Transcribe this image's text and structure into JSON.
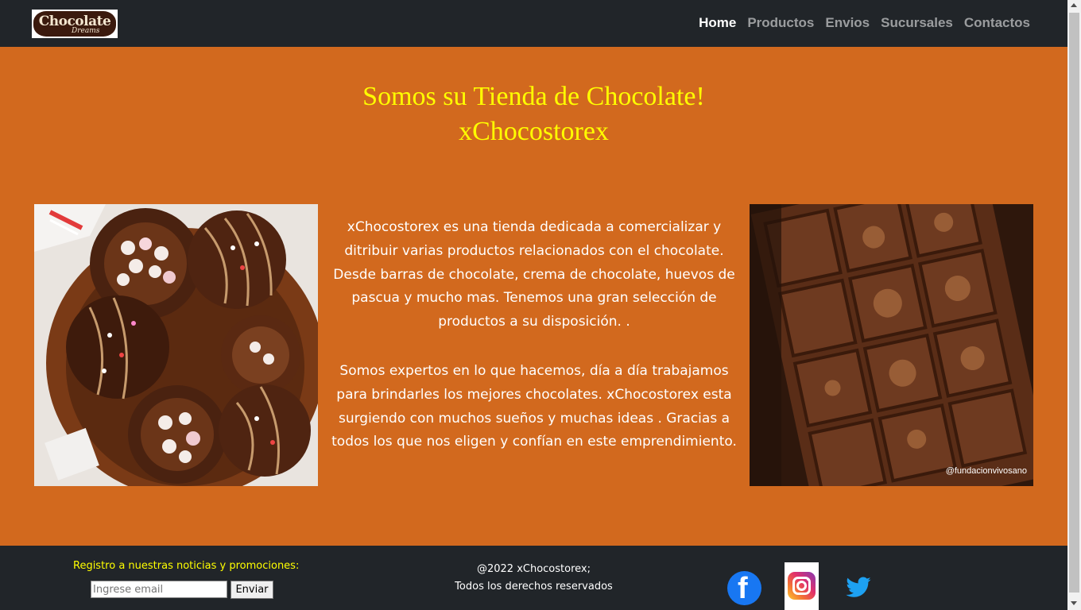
{
  "navbar": {
    "logo_text": "Chocolate",
    "logo_sub": "Dreams",
    "links": [
      "Home",
      "Productos",
      "Envios",
      "Sucursales",
      "Contactos"
    ],
    "active": "Home"
  },
  "hero": {
    "title_line1": "Somos su Tienda de Chocolate!",
    "title_line2": "xChocostorex"
  },
  "description": {
    "paragraph1": "xChocostorex es una tienda dedicada a comercializar y ditribuir varias productos relacionados con el chocolate. Desde barras de chocolate, crema de chocolate, huevos de pascua y mucho mas. Tenemos una gran selección de productos a su disposición. .",
    "paragraph2": "Somos expertos en lo que hacemos, día a día trabajamos para brindarles los mejores chocolates. xChocostorex esta surgiendo con muchos sueños y muchas ideas . Gracias a todos los que nos eligen y confían en este emprendimiento."
  },
  "images": {
    "left_watermark": "",
    "right_watermark": "@fundacionvivosano"
  },
  "footer": {
    "newsletter_label": "Registro a nuestras noticias y promociones:",
    "email_placeholder": "Ingrese email",
    "send_label": "Enviar",
    "copyright_line1": "@2022 xChocostorex;",
    "copyright_line2": "Todos los derechos reservados",
    "social": [
      "facebook-icon",
      "instagram-icon",
      "twitter-icon"
    ]
  },
  "colors": {
    "nav_bg": "#212529",
    "page_bg": "#d2691e",
    "title": "#ffff00",
    "facebook": "#1877f2",
    "twitter": "#1da1f2"
  }
}
